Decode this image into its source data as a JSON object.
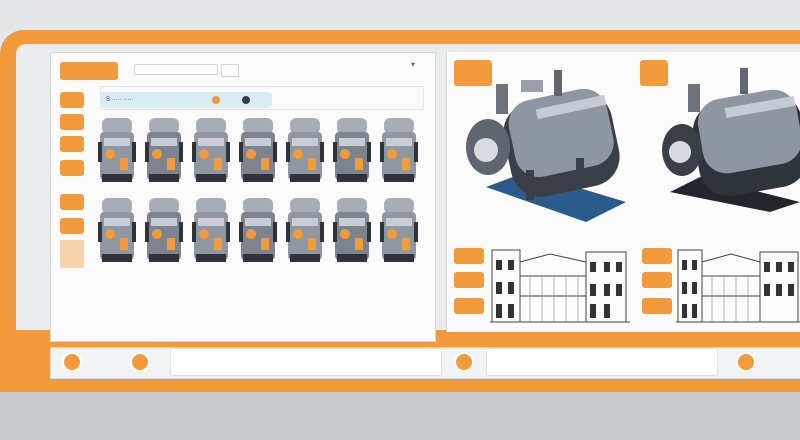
{
  "toolbar_top": {
    "button_label": "",
    "search_value": "",
    "menu_caret": "▾"
  },
  "info_bar": {
    "text": "S  ·····  ·····"
  },
  "sidebar": {
    "items": [
      {
        "label": ""
      },
      {
        "label": ""
      },
      {
        "label": ""
      },
      {
        "label": ""
      },
      {
        "label": ""
      },
      {
        "label": ""
      },
      {
        "label": ""
      }
    ]
  },
  "grid": {
    "rows": 2,
    "columns": 7
  },
  "preview": {
    "left_buttons": [
      "",
      ""
    ],
    "mid_buttons": [
      "",
      "",
      ""
    ],
    "right_buttons": [
      "",
      "",
      ""
    ]
  },
  "bottom_bar": {
    "left_icon": "gear-icon",
    "left_label": "",
    "mid_label": "",
    "right_label": "",
    "far_right_label": ""
  },
  "colors": {
    "accent": "#f39a3c",
    "frame": "#f39a3c",
    "panel": "#fbfbfb",
    "machine_body": "#7d8490",
    "machine_dark": "#2f343b",
    "base_blue": "#2b5a8c"
  }
}
